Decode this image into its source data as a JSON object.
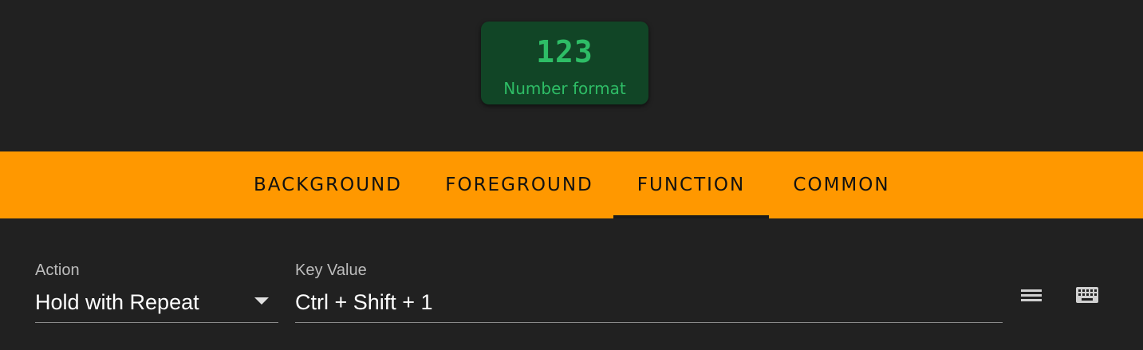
{
  "preview": {
    "key_primary": "123",
    "key_secondary": "Number format"
  },
  "tabs": [
    {
      "label": "BACKGROUND",
      "active": false
    },
    {
      "label": "FOREGROUND",
      "active": false
    },
    {
      "label": "FUNCTION",
      "active": true
    },
    {
      "label": "COMMON",
      "active": false
    }
  ],
  "action_field": {
    "label": "Action",
    "value": "Hold with Repeat"
  },
  "key_value_field": {
    "label": "Key Value",
    "value": "Ctrl + Shift + 1"
  },
  "icons": {
    "list": "menu-icon",
    "keyboard": "keyboard-icon"
  },
  "colors": {
    "background": "#212121",
    "tab_bar": "#ff9800",
    "key_tile": "#114526",
    "key_text": "#2ebd66"
  }
}
